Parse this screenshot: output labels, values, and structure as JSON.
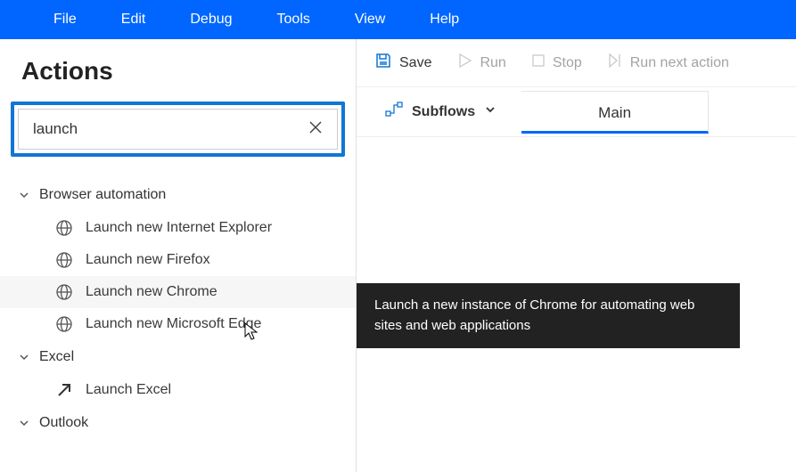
{
  "menubar": {
    "items": [
      "File",
      "Edit",
      "Debug",
      "Tools",
      "View",
      "Help"
    ]
  },
  "actions_panel": {
    "title": "Actions",
    "search_value": "launch",
    "categories": [
      {
        "label": "Browser automation",
        "expanded": true,
        "items": [
          {
            "label": "Launch new Internet Explorer",
            "icon": "globe"
          },
          {
            "label": "Launch new Firefox",
            "icon": "globe"
          },
          {
            "label": "Launch new Chrome",
            "icon": "globe",
            "hovered": true
          },
          {
            "label": "Launch new Microsoft Edge",
            "icon": "globe"
          }
        ]
      },
      {
        "label": "Excel",
        "expanded": true,
        "items": [
          {
            "label": "Launch Excel",
            "icon": "arrow"
          }
        ]
      },
      {
        "label": "Outlook",
        "expanded": true,
        "items": []
      }
    ]
  },
  "toolbar": {
    "save": "Save",
    "run": "Run",
    "stop": "Stop",
    "run_next": "Run next action"
  },
  "tabs": {
    "subflows_label": "Subflows",
    "main_label": "Main"
  },
  "tooltip": "Launch a new instance of Chrome for automating web sites and web applications"
}
